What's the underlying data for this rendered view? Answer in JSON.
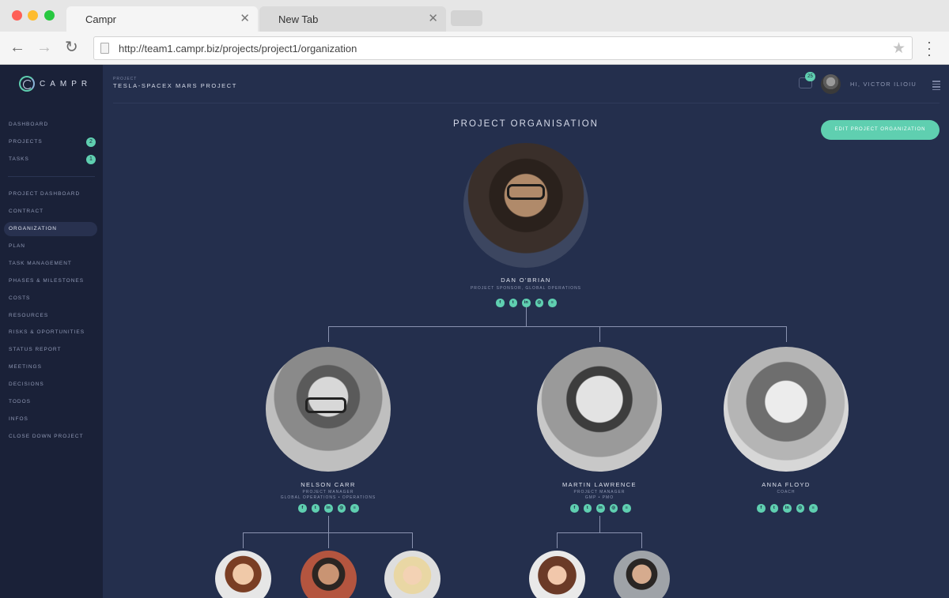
{
  "browser": {
    "tabs": [
      {
        "label": "Campr"
      },
      {
        "label": "New Tab"
      }
    ],
    "url": "http://team1.campr.biz/projects/project1/organization"
  },
  "app": {
    "logo_text": "CAMPR",
    "project_label": "PROJECT",
    "project_title": "TESLA-SPACEX MARS PROJECT",
    "chat_count": "25",
    "greeting": "HI, VICTOR ILIOIU",
    "accent_color": "#5fcfb0",
    "background_color": "#242f4d",
    "sidebar_color": "#1a2138"
  },
  "sidebar": {
    "top_items": [
      {
        "label": "DASHBOARD",
        "badge": ""
      },
      {
        "label": "PROJECTS",
        "badge": "2"
      },
      {
        "label": "TASKS",
        "badge": "1"
      }
    ],
    "project_items": [
      {
        "label": "PROJECT DASHBOARD"
      },
      {
        "label": "CONTRACT"
      },
      {
        "label": "ORGANIZATION"
      },
      {
        "label": "PLAN"
      },
      {
        "label": "TASK MANAGEMENT"
      },
      {
        "label": "PHASES & MILESTONES"
      },
      {
        "label": "COSTS"
      },
      {
        "label": "RESOURCES"
      },
      {
        "label": "RISKS & OPORTUNITIES"
      },
      {
        "label": "STATUS REPORT"
      },
      {
        "label": "MEETINGS"
      },
      {
        "label": "DECISIONS"
      },
      {
        "label": "TODOS"
      },
      {
        "label": "INFOS"
      },
      {
        "label": "CLOSE DOWN PROJECT"
      }
    ],
    "active_item": "ORGANIZATION"
  },
  "main": {
    "title": "PROJECT ORGANISATION",
    "edit_button": "EDIT PROJECT ORGANIZATION",
    "social_icons": [
      "facebook-icon",
      "twitter-icon",
      "linkedin-icon",
      "instagram-icon",
      "email-icon"
    ],
    "people": [
      {
        "name": "DAN O'BRIAN",
        "role_line1": "PROJECT SPONSOR, GLOBAL OPERATIONS",
        "role_line2": ""
      },
      {
        "name": "NELSON CARR",
        "role_line1": "PROJECT MANAGER",
        "role_line2": "GLOBAL OPERATIONS • OPERATIONS"
      },
      {
        "name": "MARTIN LAWRENCE",
        "role_line1": "PROJECT MANAGER",
        "role_line2": "GMP • PMO"
      },
      {
        "name": "ANNA FLOYD",
        "role_line1": "COACH",
        "role_line2": ""
      }
    ]
  }
}
